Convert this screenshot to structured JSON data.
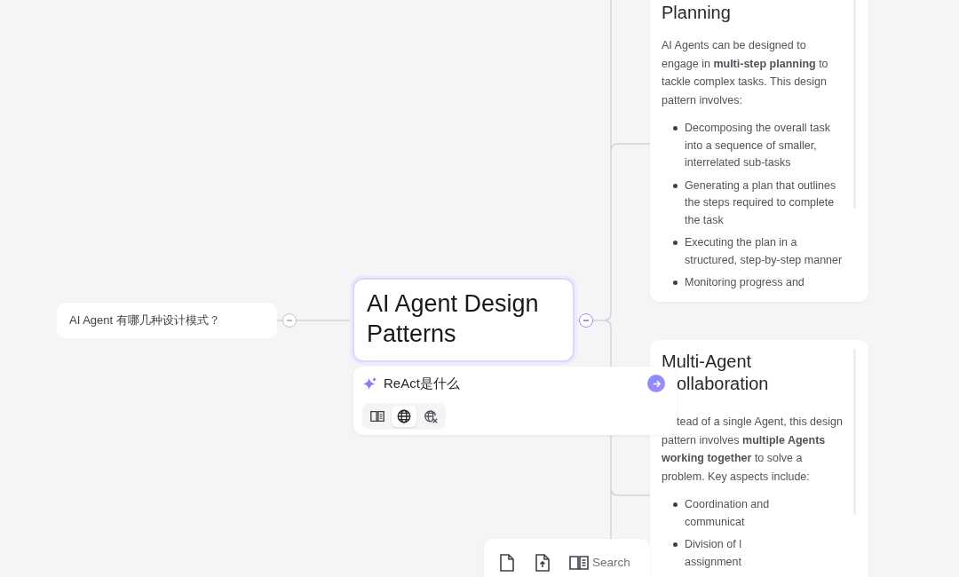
{
  "input_node": {
    "text": "AI Agent 有哪几种设计模式？",
    "collapsed": false
  },
  "root": {
    "title": "AI Agent Design Patterns",
    "selected": true,
    "collapsed": false
  },
  "ask_popup": {
    "value": "ReAct是什么",
    "modes": [
      {
        "kind": "knowledge",
        "selected": false
      },
      {
        "kind": "web",
        "selected": true
      },
      {
        "kind": "no_web",
        "selected": false
      }
    ]
  },
  "cards": [
    {
      "title_lines": [
        {
          "text": "Planning"
        }
      ],
      "paragraph": "AI Agents can be designed to engage in **multi-step planning** to tackle complex tasks. This design pattern involves:",
      "bullets": [
        [
          "Decomposing the overall task",
          "into a sequence of smaller,",
          "interrelated sub-tasks"
        ],
        [
          "Generating a plan that outlines",
          "the steps required to complete",
          "the task"
        ],
        [
          "Executing the plan in a",
          "structured, step-by-step manner"
        ],
        [
          "Monitoring progress and"
        ]
      ]
    },
    {
      "title_lines": [
        {
          "text": "Multi-Agent",
          "clipped_left": false
        },
        {
          "text": "ollaboration",
          "clipped_left": true
        }
      ],
      "lead_line": "tead of a single Agent, this design",
      "paragraph": "pattern involves **multiple Agents working together** to solve a problem. Key aspects include:",
      "bullets": [
        [
          "Coordination and",
          "communicat"
        ],
        [
          "Division of l",
          "assignment"
        ]
      ]
    }
  ],
  "toolbar": {
    "items": [
      {
        "kind": "new_file"
      },
      {
        "kind": "upload"
      },
      {
        "kind": "search",
        "label": "Search"
      }
    ]
  }
}
